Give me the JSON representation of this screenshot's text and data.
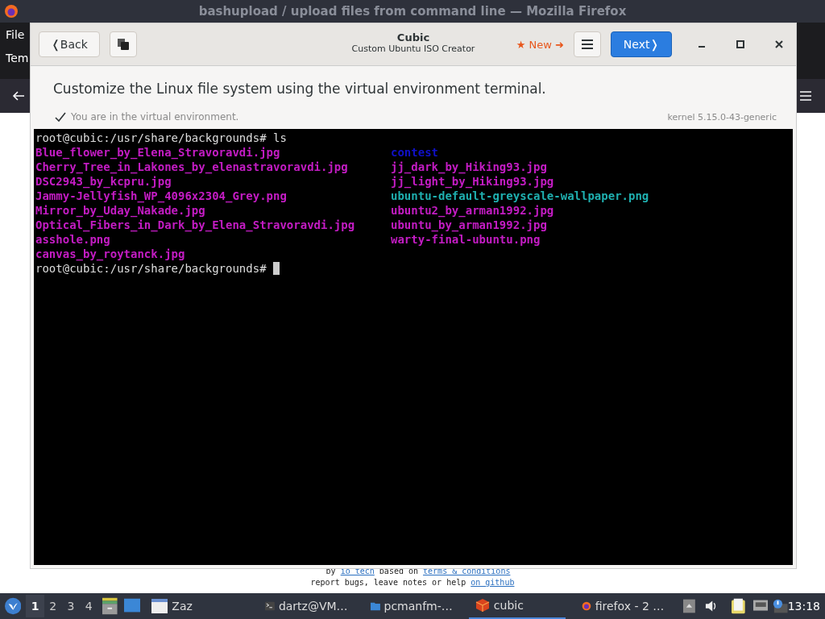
{
  "browser": {
    "title": "bashupload / upload files from command line — Mozilla Firefox",
    "menu": "File",
    "tab_partial": "Tem",
    "footer": {
      "line1": {
        "text_1": "by",
        "link_1": "io tech",
        "text_2": "based on",
        "link_2": "terms & conditions"
      },
      "line2": {
        "text": "report bugs, leave notes or help",
        "link": "on github"
      }
    }
  },
  "cubic": {
    "back": "❬Back",
    "title": "Cubic",
    "subtitle": "Custom Ubuntu ISO Creator",
    "new_badge": "★ New ➜",
    "next": "Next❭",
    "heading": "Customize the Linux file system using the virtual environment terminal.",
    "status": "You are in the virtual environment.",
    "kernel": "kernel 5.15.0-43-generic",
    "terminal": {
      "prompt": "root@cubic:/usr/share/backgrounds# ",
      "command": "ls",
      "column_1": [
        {
          "name": "Blue_flower_by_Elena_Stravoravdi.jpg",
          "kind": "image"
        },
        {
          "name": "Cherry_Tree_in_Lakones_by_elenastravoravdi.jpg",
          "kind": "image"
        },
        {
          "name": "DSC2943_by_kcpru.jpg",
          "kind": "image"
        },
        {
          "name": "Jammy-Jellyfish_WP_4096x2304_Grey.png",
          "kind": "image"
        },
        {
          "name": "Mirror_by_Uday_Nakade.jpg",
          "kind": "image"
        },
        {
          "name": "Optical_Fibers_in_Dark_by_Elena_Stravoravdi.jpg",
          "kind": "image"
        },
        {
          "name": "asshole.png",
          "kind": "image"
        },
        {
          "name": "canvas_by_roytanck.jpg",
          "kind": "image"
        }
      ],
      "column_2": [
        {
          "name": "contest",
          "kind": "directory"
        },
        {
          "name": "jj_dark_by_Hiking93.jpg",
          "kind": "image"
        },
        {
          "name": "jj_light_by_Hiking93.jpg",
          "kind": "image"
        },
        {
          "name": "ubuntu-default-greyscale-wallpaper.png",
          "kind": "link"
        },
        {
          "name": "ubuntu2_by_arman1992.jpg",
          "kind": "image"
        },
        {
          "name": "ubuntu_by_arman1992.jpg",
          "kind": "image"
        },
        {
          "name": "warty-final-ubuntu.png",
          "kind": "image"
        }
      ],
      "final_prompt": "root@cubic:/usr/share/backgrounds# "
    }
  },
  "taskbar": {
    "workspaces": [
      {
        "label": "1",
        "selected": true
      },
      {
        "label": "2",
        "selected": false
      },
      {
        "label": "3",
        "selected": false
      },
      {
        "label": "4",
        "selected": false
      }
    ],
    "launcher": "Zaz",
    "tasks": [
      {
        "label": "dartz@VM…",
        "kind": "terminal",
        "selected": false
      },
      {
        "label": "pcmanfm-…",
        "kind": "folder",
        "selected": false
      },
      {
        "label": "cubic",
        "kind": "cubic",
        "selected": true
      },
      {
        "label": "firefox - 2 …",
        "kind": "firefox",
        "selected": false
      }
    ],
    "clock": "13:18"
  }
}
